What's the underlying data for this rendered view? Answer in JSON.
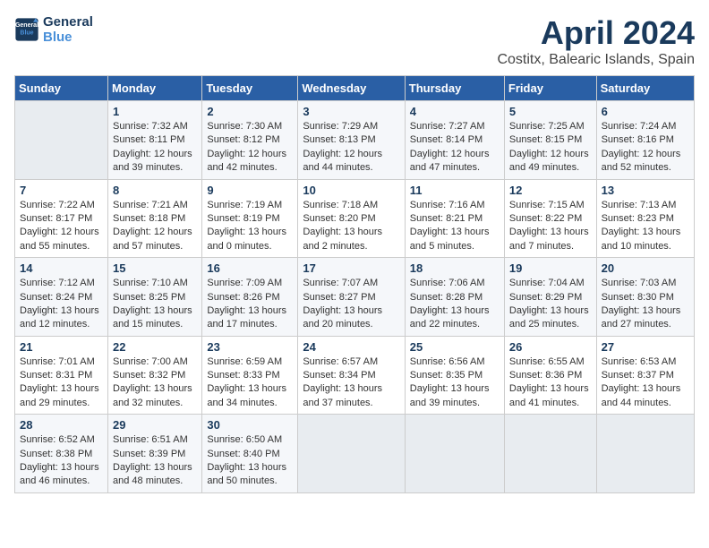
{
  "header": {
    "logo_line1": "General",
    "logo_line2": "Blue",
    "title": "April 2024",
    "subtitle": "Costitx, Balearic Islands, Spain"
  },
  "calendar": {
    "days_of_week": [
      "Sunday",
      "Monday",
      "Tuesday",
      "Wednesday",
      "Thursday",
      "Friday",
      "Saturday"
    ],
    "weeks": [
      [
        {
          "day": "",
          "empty": true
        },
        {
          "day": "1",
          "sunrise": "Sunrise: 7:32 AM",
          "sunset": "Sunset: 8:11 PM",
          "daylight": "Daylight: 12 hours and 39 minutes."
        },
        {
          "day": "2",
          "sunrise": "Sunrise: 7:30 AM",
          "sunset": "Sunset: 8:12 PM",
          "daylight": "Daylight: 12 hours and 42 minutes."
        },
        {
          "day": "3",
          "sunrise": "Sunrise: 7:29 AM",
          "sunset": "Sunset: 8:13 PM",
          "daylight": "Daylight: 12 hours and 44 minutes."
        },
        {
          "day": "4",
          "sunrise": "Sunrise: 7:27 AM",
          "sunset": "Sunset: 8:14 PM",
          "daylight": "Daylight: 12 hours and 47 minutes."
        },
        {
          "day": "5",
          "sunrise": "Sunrise: 7:25 AM",
          "sunset": "Sunset: 8:15 PM",
          "daylight": "Daylight: 12 hours and 49 minutes."
        },
        {
          "day": "6",
          "sunrise": "Sunrise: 7:24 AM",
          "sunset": "Sunset: 8:16 PM",
          "daylight": "Daylight: 12 hours and 52 minutes."
        }
      ],
      [
        {
          "day": "7",
          "sunrise": "Sunrise: 7:22 AM",
          "sunset": "Sunset: 8:17 PM",
          "daylight": "Daylight: 12 hours and 55 minutes."
        },
        {
          "day": "8",
          "sunrise": "Sunrise: 7:21 AM",
          "sunset": "Sunset: 8:18 PM",
          "daylight": "Daylight: 12 hours and 57 minutes."
        },
        {
          "day": "9",
          "sunrise": "Sunrise: 7:19 AM",
          "sunset": "Sunset: 8:19 PM",
          "daylight": "Daylight: 13 hours and 0 minutes."
        },
        {
          "day": "10",
          "sunrise": "Sunrise: 7:18 AM",
          "sunset": "Sunset: 8:20 PM",
          "daylight": "Daylight: 13 hours and 2 minutes."
        },
        {
          "day": "11",
          "sunrise": "Sunrise: 7:16 AM",
          "sunset": "Sunset: 8:21 PM",
          "daylight": "Daylight: 13 hours and 5 minutes."
        },
        {
          "day": "12",
          "sunrise": "Sunrise: 7:15 AM",
          "sunset": "Sunset: 8:22 PM",
          "daylight": "Daylight: 13 hours and 7 minutes."
        },
        {
          "day": "13",
          "sunrise": "Sunrise: 7:13 AM",
          "sunset": "Sunset: 8:23 PM",
          "daylight": "Daylight: 13 hours and 10 minutes."
        }
      ],
      [
        {
          "day": "14",
          "sunrise": "Sunrise: 7:12 AM",
          "sunset": "Sunset: 8:24 PM",
          "daylight": "Daylight: 13 hours and 12 minutes."
        },
        {
          "day": "15",
          "sunrise": "Sunrise: 7:10 AM",
          "sunset": "Sunset: 8:25 PM",
          "daylight": "Daylight: 13 hours and 15 minutes."
        },
        {
          "day": "16",
          "sunrise": "Sunrise: 7:09 AM",
          "sunset": "Sunset: 8:26 PM",
          "daylight": "Daylight: 13 hours and 17 minutes."
        },
        {
          "day": "17",
          "sunrise": "Sunrise: 7:07 AM",
          "sunset": "Sunset: 8:27 PM",
          "daylight": "Daylight: 13 hours and 20 minutes."
        },
        {
          "day": "18",
          "sunrise": "Sunrise: 7:06 AM",
          "sunset": "Sunset: 8:28 PM",
          "daylight": "Daylight: 13 hours and 22 minutes."
        },
        {
          "day": "19",
          "sunrise": "Sunrise: 7:04 AM",
          "sunset": "Sunset: 8:29 PM",
          "daylight": "Daylight: 13 hours and 25 minutes."
        },
        {
          "day": "20",
          "sunrise": "Sunrise: 7:03 AM",
          "sunset": "Sunset: 8:30 PM",
          "daylight": "Daylight: 13 hours and 27 minutes."
        }
      ],
      [
        {
          "day": "21",
          "sunrise": "Sunrise: 7:01 AM",
          "sunset": "Sunset: 8:31 PM",
          "daylight": "Daylight: 13 hours and 29 minutes."
        },
        {
          "day": "22",
          "sunrise": "Sunrise: 7:00 AM",
          "sunset": "Sunset: 8:32 PM",
          "daylight": "Daylight: 13 hours and 32 minutes."
        },
        {
          "day": "23",
          "sunrise": "Sunrise: 6:59 AM",
          "sunset": "Sunset: 8:33 PM",
          "daylight": "Daylight: 13 hours and 34 minutes."
        },
        {
          "day": "24",
          "sunrise": "Sunrise: 6:57 AM",
          "sunset": "Sunset: 8:34 PM",
          "daylight": "Daylight: 13 hours and 37 minutes."
        },
        {
          "day": "25",
          "sunrise": "Sunrise: 6:56 AM",
          "sunset": "Sunset: 8:35 PM",
          "daylight": "Daylight: 13 hours and 39 minutes."
        },
        {
          "day": "26",
          "sunrise": "Sunrise: 6:55 AM",
          "sunset": "Sunset: 8:36 PM",
          "daylight": "Daylight: 13 hours and 41 minutes."
        },
        {
          "day": "27",
          "sunrise": "Sunrise: 6:53 AM",
          "sunset": "Sunset: 8:37 PM",
          "daylight": "Daylight: 13 hours and 44 minutes."
        }
      ],
      [
        {
          "day": "28",
          "sunrise": "Sunrise: 6:52 AM",
          "sunset": "Sunset: 8:38 PM",
          "daylight": "Daylight: 13 hours and 46 minutes."
        },
        {
          "day": "29",
          "sunrise": "Sunrise: 6:51 AM",
          "sunset": "Sunset: 8:39 PM",
          "daylight": "Daylight: 13 hours and 48 minutes."
        },
        {
          "day": "30",
          "sunrise": "Sunrise: 6:50 AM",
          "sunset": "Sunset: 8:40 PM",
          "daylight": "Daylight: 13 hours and 50 minutes."
        },
        {
          "day": "",
          "empty": true
        },
        {
          "day": "",
          "empty": true
        },
        {
          "day": "",
          "empty": true
        },
        {
          "day": "",
          "empty": true
        }
      ]
    ]
  }
}
